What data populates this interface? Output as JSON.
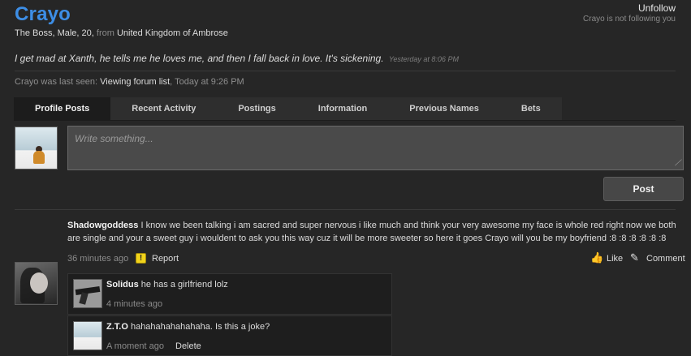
{
  "profile": {
    "username": "Crayo",
    "unfollow_label": "Unfollow",
    "follow_status": "Crayo is not following you",
    "info_prefix": "The Boss, Male, 20,",
    "info_from": "from",
    "location": "United Kingdom of Ambrose",
    "status_text": "I get mad at Xanth, he tells me he loves me, and then I fall back in love. It's sickening.",
    "status_time": "Yesterday at 8:06 PM",
    "last_seen_prefix": "Crayo was last seen:",
    "last_seen_activity": "Viewing forum list",
    "last_seen_time": ", Today at 9:26 PM"
  },
  "tabs": [
    {
      "label": "Profile Posts"
    },
    {
      "label": "Recent Activity"
    },
    {
      "label": "Postings"
    },
    {
      "label": "Information"
    },
    {
      "label": "Previous Names"
    },
    {
      "label": "Bets"
    }
  ],
  "composer": {
    "placeholder": "Write something...",
    "post_label": "Post"
  },
  "posts": [
    {
      "author": "Shadowgoddess",
      "text": "I know we been talking i am sacred and super nervous i like much and think your very awesome my face is whole red right now we both are single and your a sweet guy i wouldent to ask you this way cuz it will be more sweeter so here it goes Crayo will you be my boyfriend :8 :8 :8 :8 :8 :8",
      "time": "36 minutes ago",
      "report_label": "Report",
      "like_label": "Like",
      "comment_label": "Comment",
      "comments": [
        {
          "author": "Solidus",
          "text": "he has a girlfriend lolz",
          "time": "4 minutes ago"
        },
        {
          "author": "Z.T.O",
          "text": "hahahahahahahaha. Is this a joke?",
          "time": "A moment ago",
          "delete_label": "Delete"
        }
      ]
    }
  ],
  "colors": {
    "accent": "#3d8ee6",
    "background": "#262626",
    "report_icon": "#f1d31b"
  }
}
